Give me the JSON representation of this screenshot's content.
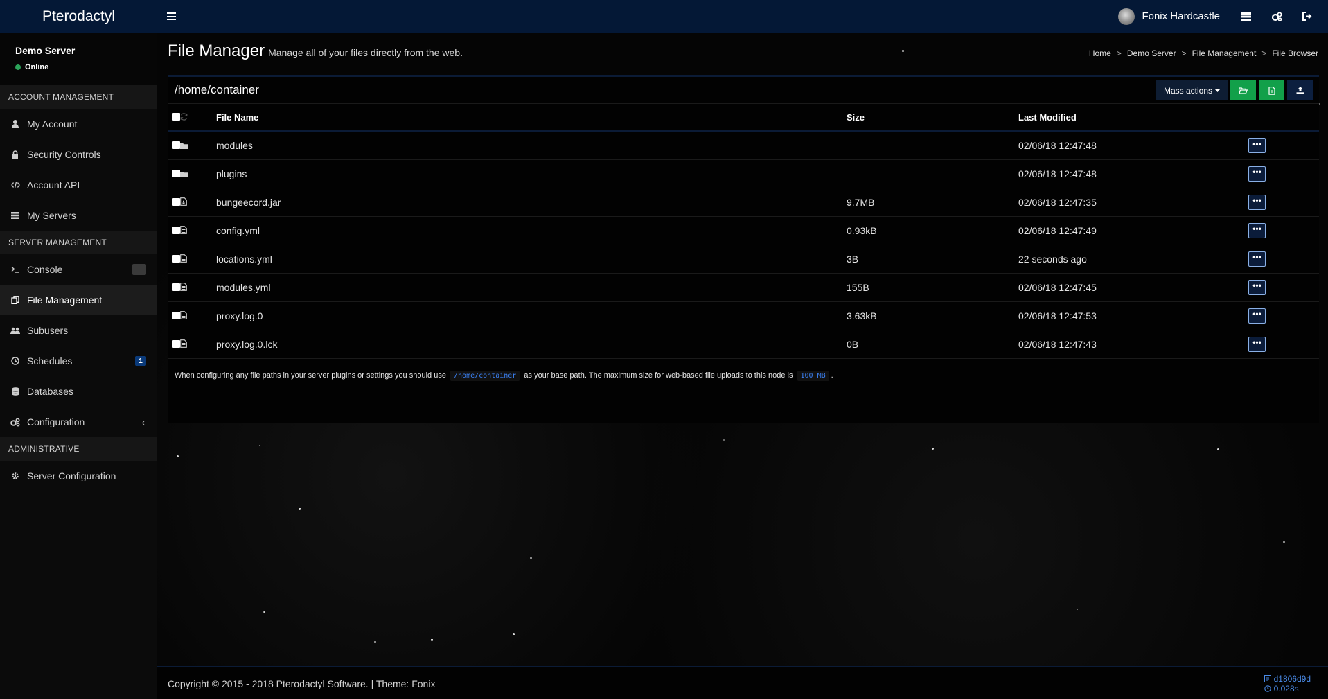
{
  "brand": "Pterodactyl",
  "topbar": {
    "user_name": "Fonix Hardcastle"
  },
  "server": {
    "name": "Demo Server",
    "status": "Online"
  },
  "sidebar": {
    "account_header": "ACCOUNT MANAGEMENT",
    "account_items": [
      {
        "label": "My Account",
        "icon": "user-icon"
      },
      {
        "label": "Security Controls",
        "icon": "lock-icon"
      },
      {
        "label": "Account API",
        "icon": "code-icon"
      },
      {
        "label": "My Servers",
        "icon": "server-icon"
      }
    ],
    "server_header": "SERVER MANAGEMENT",
    "server_items": [
      {
        "label": "Console",
        "icon": "terminal-icon"
      },
      {
        "label": "File Management",
        "icon": "files-icon",
        "active": true
      },
      {
        "label": "Subusers",
        "icon": "users-icon"
      },
      {
        "label": "Schedules",
        "icon": "clock-icon",
        "badge": "1"
      },
      {
        "label": "Databases",
        "icon": "database-icon"
      },
      {
        "label": "Configuration",
        "icon": "gears-icon",
        "chevron": "‹"
      }
    ],
    "admin_header": "ADMINISTRATIVE",
    "admin_items": [
      {
        "label": "Server Configuration",
        "icon": "gear-icon"
      }
    ]
  },
  "header": {
    "title": "File Manager",
    "subtitle": "Manage all of your files directly from the web.",
    "breadcrumb": [
      "Home",
      "Demo Server",
      "File Management",
      "File Browser"
    ],
    "breadcrumb_sep": ">"
  },
  "filebox": {
    "path": "/home/container",
    "mass_actions": "Mass actions",
    "columns": {
      "name": "File Name",
      "size": "Size",
      "modified": "Last Modified"
    },
    "files": [
      {
        "name": "modules",
        "size": "",
        "modified": "02/06/18 12:47:48",
        "type": "folder"
      },
      {
        "name": "plugins",
        "size": "",
        "modified": "02/06/18 12:47:48",
        "type": "folder"
      },
      {
        "name": "bungeecord.jar",
        "size": "9.7MB",
        "modified": "02/06/18 12:47:35",
        "type": "archive"
      },
      {
        "name": "config.yml",
        "size": "0.93kB",
        "modified": "02/06/18 12:47:49",
        "type": "file"
      },
      {
        "name": "locations.yml",
        "size": "3B",
        "modified": "22 seconds ago",
        "type": "file"
      },
      {
        "name": "modules.yml",
        "size": "155B",
        "modified": "02/06/18 12:47:45",
        "type": "file"
      },
      {
        "name": "proxy.log.0",
        "size": "3.63kB",
        "modified": "02/06/18 12:47:53",
        "type": "file"
      },
      {
        "name": "proxy.log.0.lck",
        "size": "0B",
        "modified": "02/06/18 12:47:43",
        "type": "file"
      }
    ],
    "row_menu": "•••",
    "note_prefix": "When configuring any file paths in your server plugins or settings you should use",
    "note_path": "/home/container",
    "note_middle": "as your base path. The maximum size for web-based file uploads to this node is",
    "note_size": "100 MB",
    "note_suffix": "."
  },
  "footer": {
    "copyright": "Copyright © 2015 - 2018 Pterodactyl Software. | Theme: Fonix",
    "version": "d1806d9d",
    "time": "0.028s"
  },
  "colors": {
    "topbar": "#041836",
    "accent_blue": "#3b82f6",
    "green": "#12a04a",
    "online": "#2ca35a"
  }
}
